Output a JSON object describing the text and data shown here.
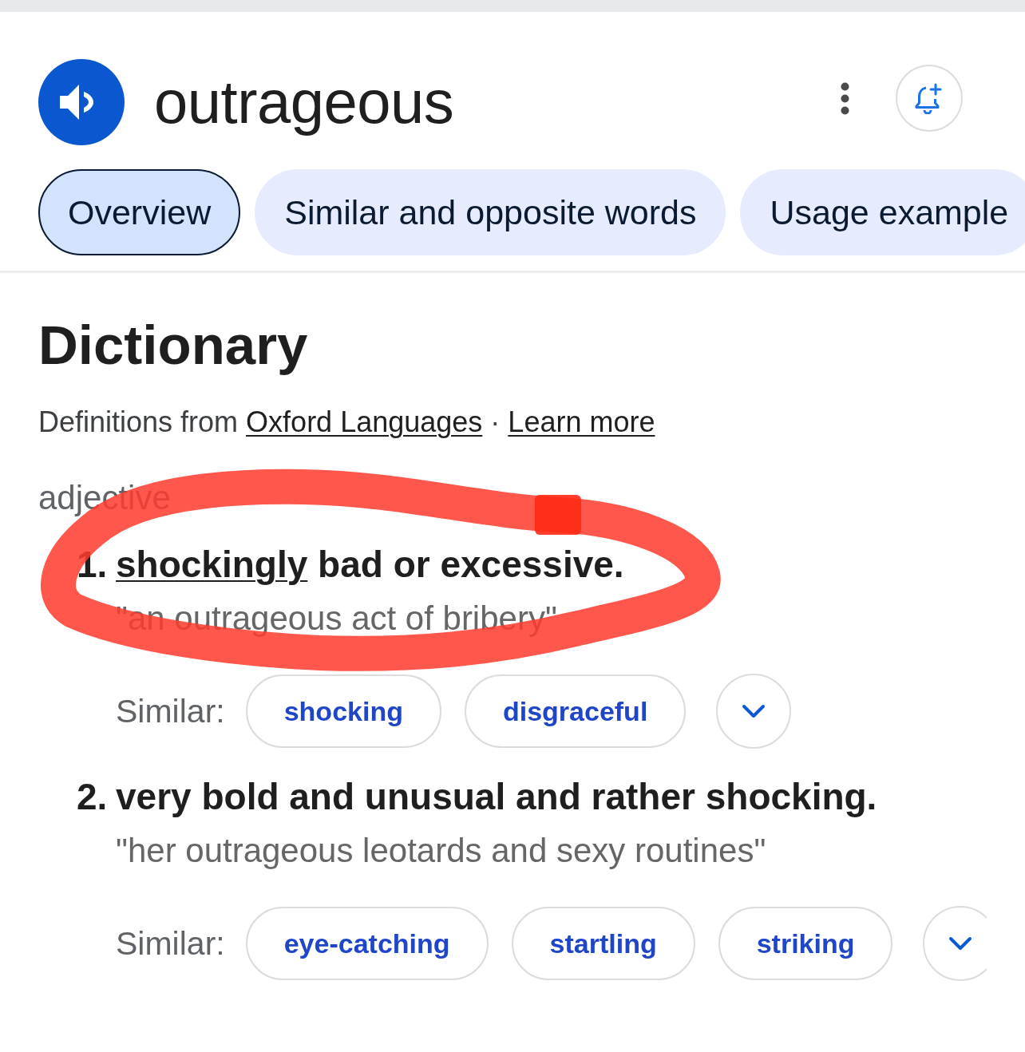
{
  "header": {
    "title": "outrageous"
  },
  "tabs": [
    {
      "label": "Overview",
      "selected": true
    },
    {
      "label": "Similar and opposite words",
      "selected": false
    },
    {
      "label": "Usage example",
      "selected": false
    }
  ],
  "dictionary": {
    "heading": "Dictionary",
    "attribution": {
      "prefix": "Definitions from",
      "source_link": "Oxford Languages",
      "separator": "·",
      "learn_more_link": "Learn more"
    },
    "part_of_speech": "adjective",
    "senses": [
      {
        "number": "1.",
        "definition": [
          {
            "kind": "link",
            "text": "shockingly"
          },
          {
            "kind": "plain",
            "text": "bad or excessive."
          }
        ],
        "example": "\"an outrageous act of bribery\"",
        "similar_label": "Similar:",
        "similar": [
          "shocking",
          "disgraceful"
        ]
      },
      {
        "number": "2.",
        "definition": [
          {
            "kind": "plain",
            "text": "very bold and unusual and rather shocking."
          }
        ],
        "example": "\"her outrageous leotards and sexy routines\"",
        "similar_label": "Similar:",
        "similar": [
          "eye-catching",
          "startling",
          "striking"
        ]
      }
    ]
  },
  "annotation": {
    "kind": "freehand-loop"
  }
}
